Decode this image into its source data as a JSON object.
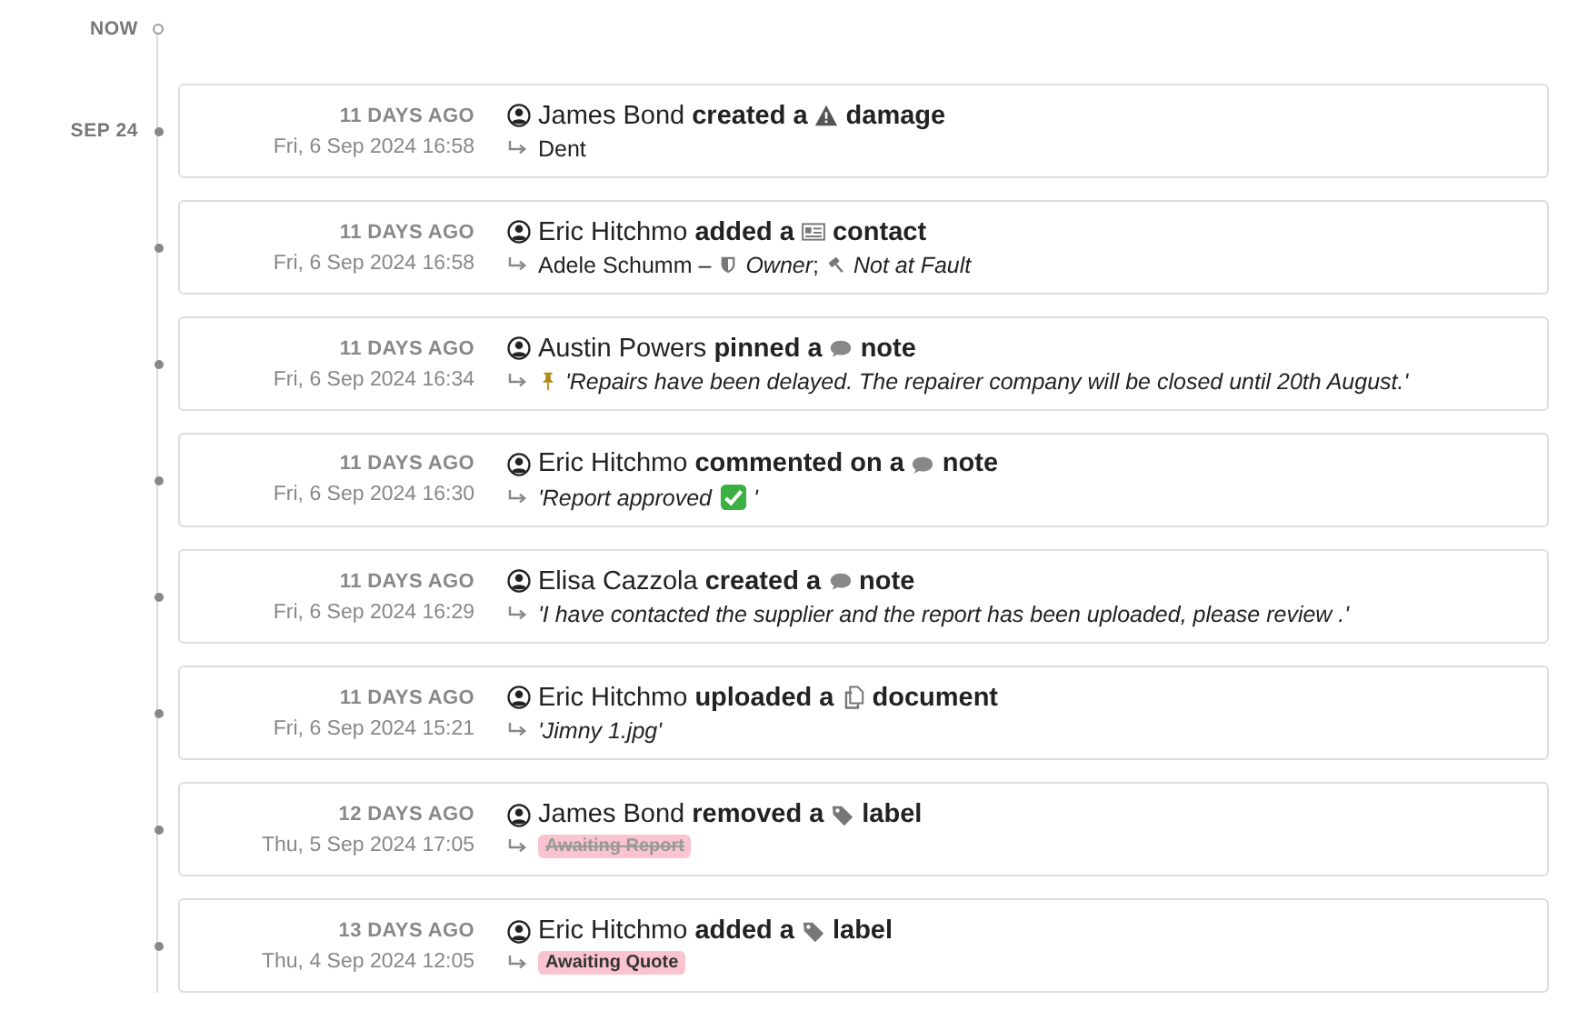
{
  "now_label": "NOW",
  "entries": [
    {
      "date_label": "SEP 24",
      "relative": "11 DAYS AGO",
      "timestamp": "Fri, 6 Sep 2024 16:58",
      "actor": "James Bond",
      "action": "created a",
      "object": {
        "kind": "warning",
        "text": "damage"
      },
      "detail": [
        {
          "kind": "text",
          "text": "Dent",
          "italic": false
        }
      ]
    },
    {
      "relative": "11 DAYS AGO",
      "timestamp": "Fri, 6 Sep 2024 16:58",
      "actor": "Eric Hitchmo",
      "action": "added a",
      "object": {
        "kind": "contact",
        "text": "contact"
      },
      "detail": [
        {
          "kind": "text",
          "text": "Adele Schumm –",
          "italic": false
        },
        {
          "kind": "shield"
        },
        {
          "kind": "text",
          "text": "*Owner*;",
          "italic": false
        },
        {
          "kind": "gavel"
        },
        {
          "kind": "text",
          "text": "Not at Fault",
          "italic": true
        }
      ]
    },
    {
      "relative": "11 DAYS AGO",
      "timestamp": "Fri, 6 Sep 2024 16:34",
      "actor": "Austin Powers",
      "action": "pinned a",
      "object": {
        "kind": "note",
        "text": "note"
      },
      "detail": [
        {
          "kind": "pin"
        },
        {
          "kind": "text",
          "text": "'Repairs have been delayed. The repairer company will be closed until 20th August.'",
          "italic": true
        }
      ]
    },
    {
      "relative": "11 DAYS AGO",
      "timestamp": "Fri, 6 Sep 2024 16:30",
      "actor": "Eric Hitchmo",
      "action": "commented on a",
      "object": {
        "kind": "note",
        "text": "note"
      },
      "detail": [
        {
          "kind": "text",
          "text": "'Report approved",
          "italic": true
        },
        {
          "kind": "check"
        },
        {
          "kind": "text",
          "text": "'",
          "italic": true
        }
      ]
    },
    {
      "relative": "11 DAYS AGO",
      "timestamp": "Fri, 6 Sep 2024 16:29",
      "actor": "Elisa Cazzola",
      "action": "created a",
      "object": {
        "kind": "note",
        "text": "note"
      },
      "detail": [
        {
          "kind": "text",
          "text": "'I have contacted the supplier and the report has been uploaded, please review .'",
          "italic": true
        }
      ]
    },
    {
      "relative": "11 DAYS AGO",
      "timestamp": "Fri, 6 Sep 2024 15:21",
      "actor": "Eric Hitchmo",
      "action": "uploaded a",
      "object": {
        "kind": "document",
        "text": "document"
      },
      "detail": [
        {
          "kind": "text",
          "text": "'Jimny 1.jpg'",
          "italic": true
        }
      ]
    },
    {
      "relative": "12 DAYS AGO",
      "timestamp": "Thu, 5 Sep 2024 17:05",
      "actor": "James Bond",
      "action": "removed a",
      "object": {
        "kind": "label",
        "text": "label"
      },
      "detail": [
        {
          "kind": "label",
          "text": "Awaiting Report",
          "struck": true
        }
      ]
    },
    {
      "relative": "13 DAYS AGO",
      "timestamp": "Thu, 4 Sep 2024 12:05",
      "actor": "Eric Hitchmo",
      "action": "added a",
      "object": {
        "kind": "label",
        "text": "label"
      },
      "detail": [
        {
          "kind": "label",
          "text": "Awaiting Quote",
          "struck": false
        }
      ]
    }
  ]
}
